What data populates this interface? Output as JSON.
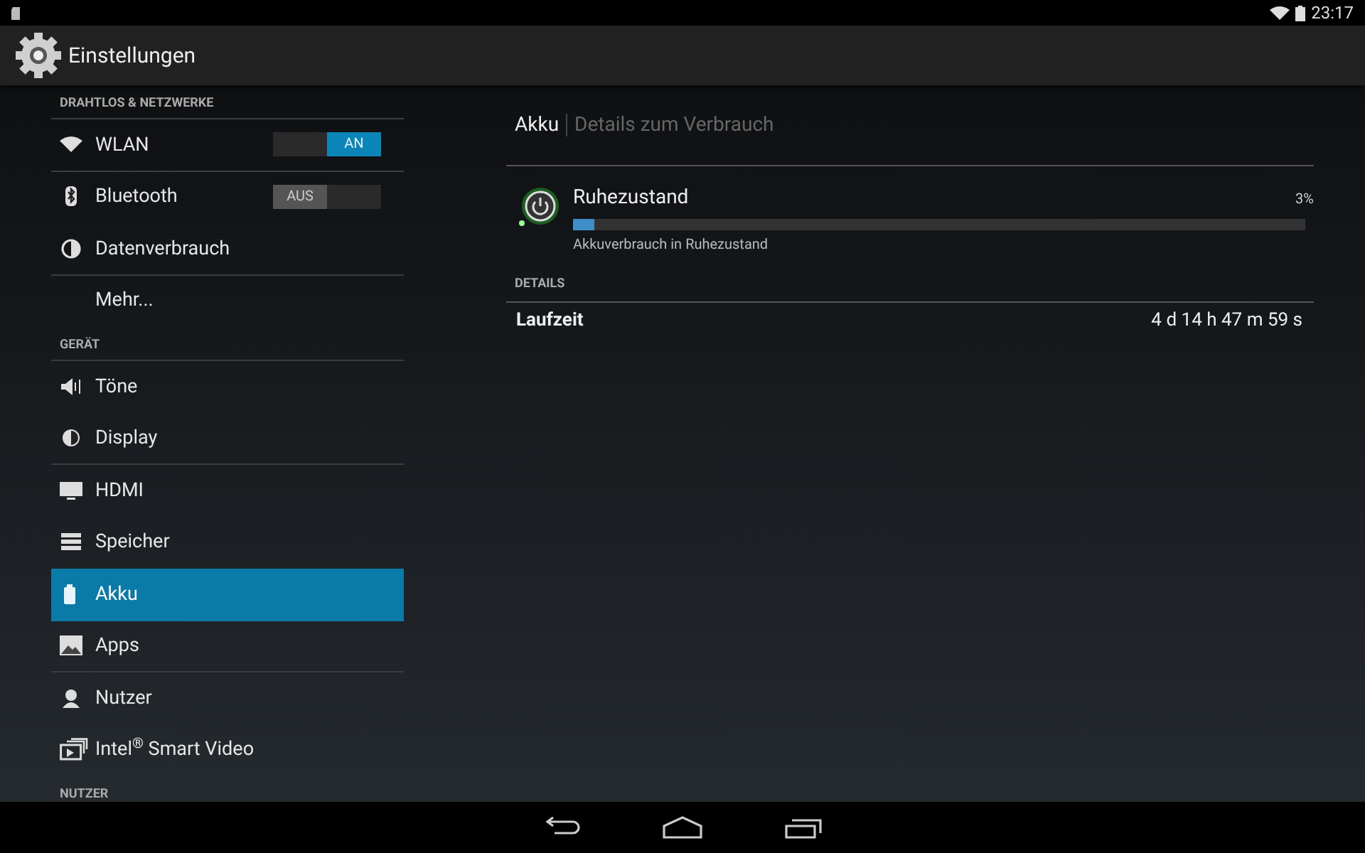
{
  "status_bar": {
    "time": "23:17"
  },
  "action_bar": {
    "title": "Einstellungen"
  },
  "sidebar": {
    "sections": [
      {
        "header": "DRAHTLOS & NETZWERKE",
        "items": [
          {
            "label": "WLAN",
            "selected": false,
            "divider_below": true,
            "toggle": {
              "label": "AN",
              "on": true
            }
          },
          {
            "label": "Bluetooth",
            "selected": false,
            "divider_below": false,
            "toggle": {
              "label": "AUS",
              "on": false
            }
          },
          {
            "label": "Datenverbrauch",
            "selected": false,
            "divider_below": true
          },
          {
            "label": "Mehr...",
            "selected": false,
            "divider_below": false
          }
        ]
      },
      {
        "header": "GERÄT",
        "items": [
          {
            "label": "Töne",
            "selected": false,
            "divider_below": false
          },
          {
            "label": "Display",
            "selected": false,
            "divider_below": true
          },
          {
            "label": "HDMI",
            "selected": false,
            "divider_below": false
          },
          {
            "label": "Speicher",
            "selected": false,
            "divider_below": false
          },
          {
            "label": "Akku",
            "selected": true,
            "divider_below": false
          },
          {
            "label": "Apps",
            "selected": false,
            "divider_below": true
          },
          {
            "label": "Nutzer",
            "selected": false,
            "divider_below": false
          },
          {
            "label": "Intel$^{®}$ Smart Video",
            "selected": false,
            "divider_below": false
          }
        ]
      },
      {
        "header": "NUTZER"
      }
    ]
  },
  "detail": {
    "breadcrumb": [
      "Akku",
      "Details zum Verbrauch"
    ],
    "usage": {
      "name": "Ruhezustand",
      "percent": "3%",
      "level": 0.03,
      "subtitle": "Akkuverbrauch in Ruhezustand"
    },
    "section_header": "DETAILS",
    "rows": [
      {
        "label": "Laufzeit",
        "value": "4 d 14 h 47 m 59 s"
      }
    ]
  }
}
